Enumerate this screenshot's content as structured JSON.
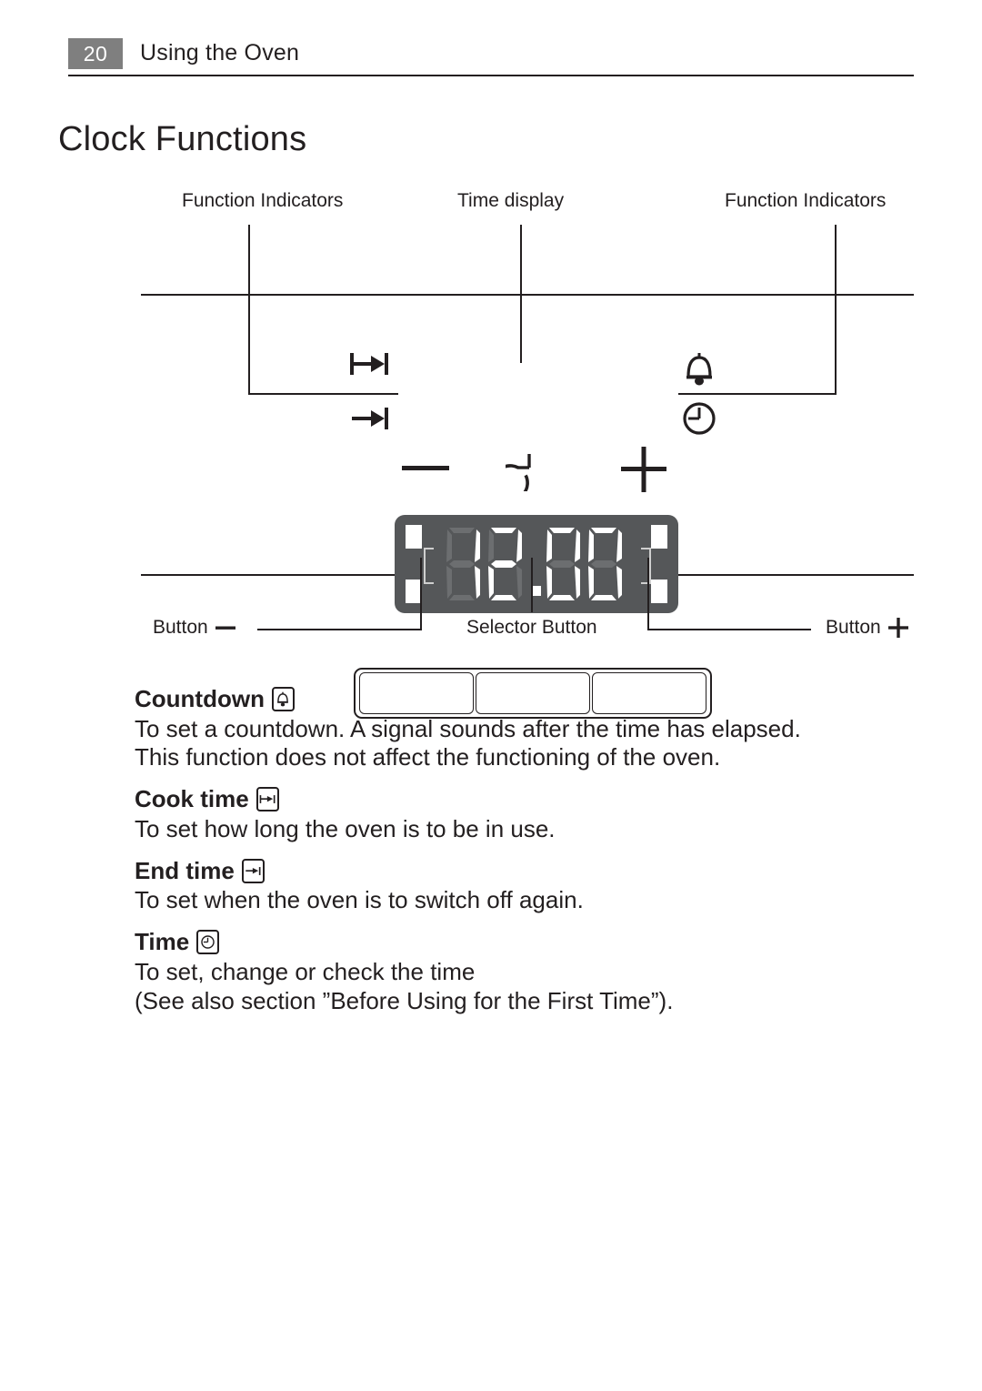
{
  "header": {
    "page_number": "20",
    "title": "Using the Oven"
  },
  "chapter": {
    "title": "Clock Functions"
  },
  "diagram": {
    "labels": {
      "top_left": "Function Indicators",
      "top_center": "Time display",
      "top_right": "Function Indicators",
      "bottom_left": "Button",
      "bottom_left_symbol": "—",
      "bottom_center": "Selector Button",
      "bottom_right": "Button",
      "bottom_right_symbol": "+"
    },
    "display": {
      "value": "12.00",
      "digits": [
        "1",
        "2",
        "0",
        "0"
      ],
      "background_color": "#555759",
      "lit_segment_color": "#ffffff",
      "unlit_segment_color": "#6c6e70"
    },
    "indicator_icons": {
      "left_top": "cook-time-icon",
      "left_bottom": "end-time-icon",
      "right_top": "bell-icon",
      "right_bottom": "clock-icon"
    },
    "button_symbols": {
      "minus": "minus-icon",
      "selector": "selector-clock-icon",
      "plus": "plus-icon"
    },
    "buttons": [
      "minus-button",
      "selector-button",
      "plus-button"
    ]
  },
  "sections": [
    {
      "heading": "Countdown",
      "icon": "bell-icon",
      "lines": [
        "To set a countdown. A signal sounds after the time has elapsed.",
        "This function does not affect the functioning of the oven."
      ]
    },
    {
      "heading": "Cook time",
      "icon": "cook-time-icon",
      "lines": [
        "To set how long the oven is to be in use."
      ]
    },
    {
      "heading": "End time",
      "icon": "end-time-icon",
      "lines": [
        "To set when the oven is to switch off again."
      ]
    },
    {
      "heading": "Time",
      "icon": "clock-icon",
      "lines": [
        "To set, change or check the time",
        "(See also section ”Before Using for the First Time”)."
      ]
    }
  ]
}
